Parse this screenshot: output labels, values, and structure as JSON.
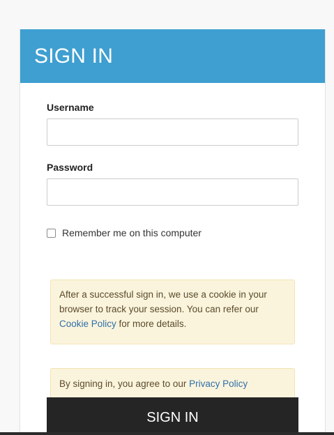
{
  "header": {
    "title": "SIGN IN"
  },
  "form": {
    "username_label": "Username",
    "username_value": "",
    "password_label": "Password",
    "password_value": "",
    "remember_label": "Remember me on this computer",
    "remember_checked": false
  },
  "notices": {
    "cookie_text_before": "After a successful sign in, we use a cookie in your browser to track your session. You can refer our ",
    "cookie_link": "Cookie Policy",
    "cookie_text_after": " for more details.",
    "privacy_text_before": "By signing in, you agree to our ",
    "privacy_link": "Privacy Policy"
  },
  "actions": {
    "signin_label": "SIGN IN"
  },
  "colors": {
    "header_bg": "#3e9fd0",
    "button_bg": "#252525",
    "notice_bg": "#fbf4dd",
    "link": "#2f6fa8"
  }
}
